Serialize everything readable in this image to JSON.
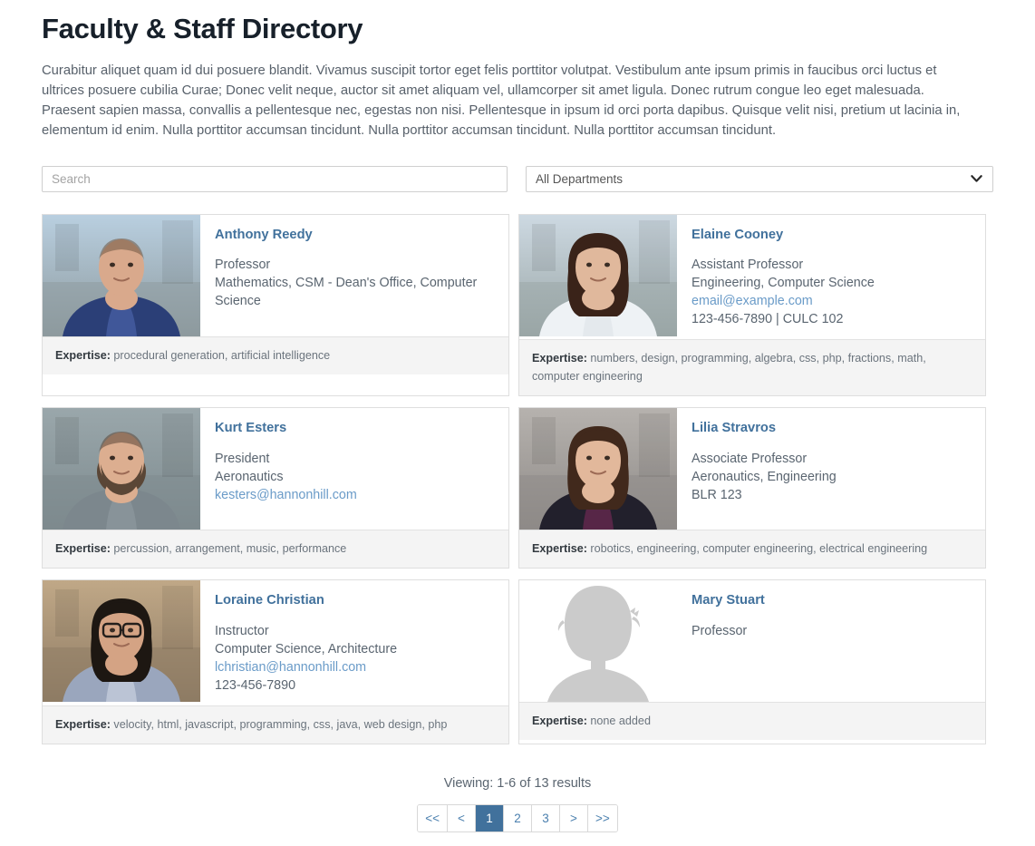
{
  "header": {
    "title": "Faculty & Staff Directory",
    "intro": "Curabitur aliquet quam id dui posuere blandit. Vivamus suscipit tortor eget felis porttitor volutpat. Vestibulum ante ipsum primis in faucibus orci luctus et ultrices posuere cubilia Curae; Donec velit neque, auctor sit amet aliquam vel, ullamcorper sit amet ligula. Donec rutrum congue leo eget malesuada. Praesent sapien massa, convallis a pellentesque nec, egestas non nisi. Pellentesque in ipsum id orci porta dapibus. Quisque velit nisi, pretium ut lacinia in, elementum id enim. Nulla porttitor accumsan tincidunt. Nulla porttitor accumsan tincidunt. Nulla porttitor accumsan tincidunt."
  },
  "controls": {
    "search": {
      "placeholder": "Search",
      "value": ""
    },
    "department_filter": {
      "selected": "All Departments",
      "icon": "chevron-down-icon"
    }
  },
  "expertise_label": "Expertise:",
  "people": [
    {
      "name": "Anthony Reedy",
      "title": "Professor",
      "departments": "Mathematics, CSM - Dean's Office, Computer Science",
      "email": "",
      "contact": "",
      "expertise": "procedural generation, artificial intelligence",
      "photo": "photo-man-plaid-shirt"
    },
    {
      "name": "Elaine Cooney",
      "title": "Assistant Professor",
      "departments": "Engineering, Computer Science",
      "email": "email@example.com",
      "contact": "123-456-7890 | CULC 102",
      "expertise": "numbers, design, programming, algebra, css, php, fractions, math, computer engineering",
      "photo": "photo-woman-white-top"
    },
    {
      "name": "Kurt Esters",
      "title": "President",
      "departments": "Aeronautics",
      "email": "kesters@hannonhill.com",
      "contact": "",
      "expertise": "percussion, arrangement, music, performance",
      "photo": "photo-man-bearded-gray-polo"
    },
    {
      "name": "Lilia Stravros",
      "title": "Associate Professor",
      "departments": "Aeronautics, Engineering",
      "email": "",
      "contact": "BLR 123",
      "expertise": "robotics, engineering, computer engineering, electrical engineering",
      "photo": "photo-woman-dark-jacket"
    },
    {
      "name": "Loraine Christian",
      "title": "Instructor",
      "departments": "Computer Science, Architecture",
      "email": "lchristian@hannonhill.com",
      "contact": "123-456-7890",
      "expertise": "velocity, html, javascript, programming, css, java, web design, php",
      "photo": "photo-woman-glasses-striped-shirt"
    },
    {
      "name": "Mary Stuart",
      "title": "Professor",
      "departments": "",
      "email": "",
      "contact": "",
      "expertise": "none added",
      "photo": "avatar-placeholder-silhouette"
    }
  ],
  "footer": {
    "viewing": "Viewing: 1-6 of 13 results",
    "pagination": [
      {
        "label": "<<",
        "name": "first",
        "active": false
      },
      {
        "label": "<",
        "name": "previous",
        "active": false
      },
      {
        "label": "1",
        "name": "page-1",
        "active": true
      },
      {
        "label": "2",
        "name": "page-2",
        "active": false
      },
      {
        "label": "3",
        "name": "page-3",
        "active": false
      },
      {
        "label": ">",
        "name": "next",
        "active": false
      },
      {
        "label": ">>",
        "name": "last",
        "active": false
      }
    ]
  },
  "colors": {
    "accent": "#41719c",
    "link": "#6a9bc8",
    "title": "#17202a",
    "body": "#58616b",
    "expertise_bg": "#f4f4f4",
    "border": "#dedede"
  }
}
